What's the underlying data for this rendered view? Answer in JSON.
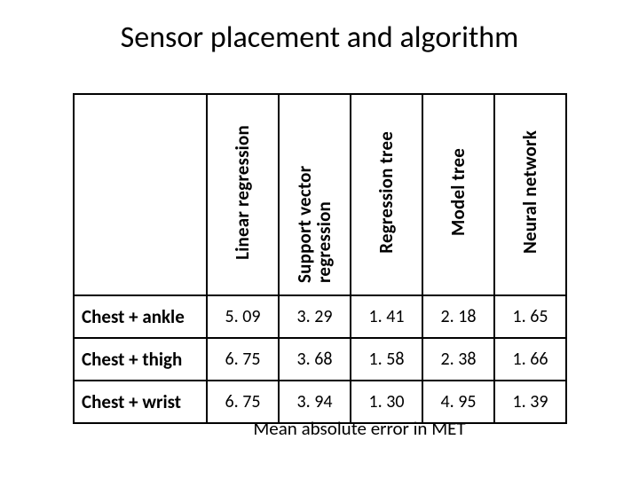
{
  "title": "Sensor placement and algorithm",
  "columns": [
    "Linear regression",
    "Support vector regression",
    "Regression tree",
    "Model tree",
    "Neural network"
  ],
  "rows": [
    {
      "label": "Chest + ankle",
      "values": [
        "5. 09",
        "3. 29",
        "1. 41",
        "2. 18",
        "1. 65"
      ]
    },
    {
      "label": "Chest + thigh",
      "values": [
        "6. 75",
        "3. 68",
        "1. 58",
        "2. 38",
        "1. 66"
      ]
    },
    {
      "label": "Chest + wrist",
      "values": [
        "6. 75",
        "3. 94",
        "1. 30",
        "4. 95",
        "1. 39"
      ]
    }
  ],
  "caption": "Mean absolute error in MET",
  "chart_data": {
    "type": "table",
    "title": "Sensor placement and algorithm — Mean absolute error in MET",
    "columns": [
      "Linear regression",
      "Support vector regression",
      "Regression tree",
      "Model tree",
      "Neural network"
    ],
    "rows": [
      "Chest + ankle",
      "Chest + thigh",
      "Chest + wrist"
    ],
    "values": [
      [
        5.09,
        3.29,
        1.41,
        2.18,
        1.65
      ],
      [
        6.75,
        3.68,
        1.58,
        2.38,
        1.66
      ],
      [
        6.75,
        3.94,
        1.3,
        4.95,
        1.39
      ]
    ]
  }
}
